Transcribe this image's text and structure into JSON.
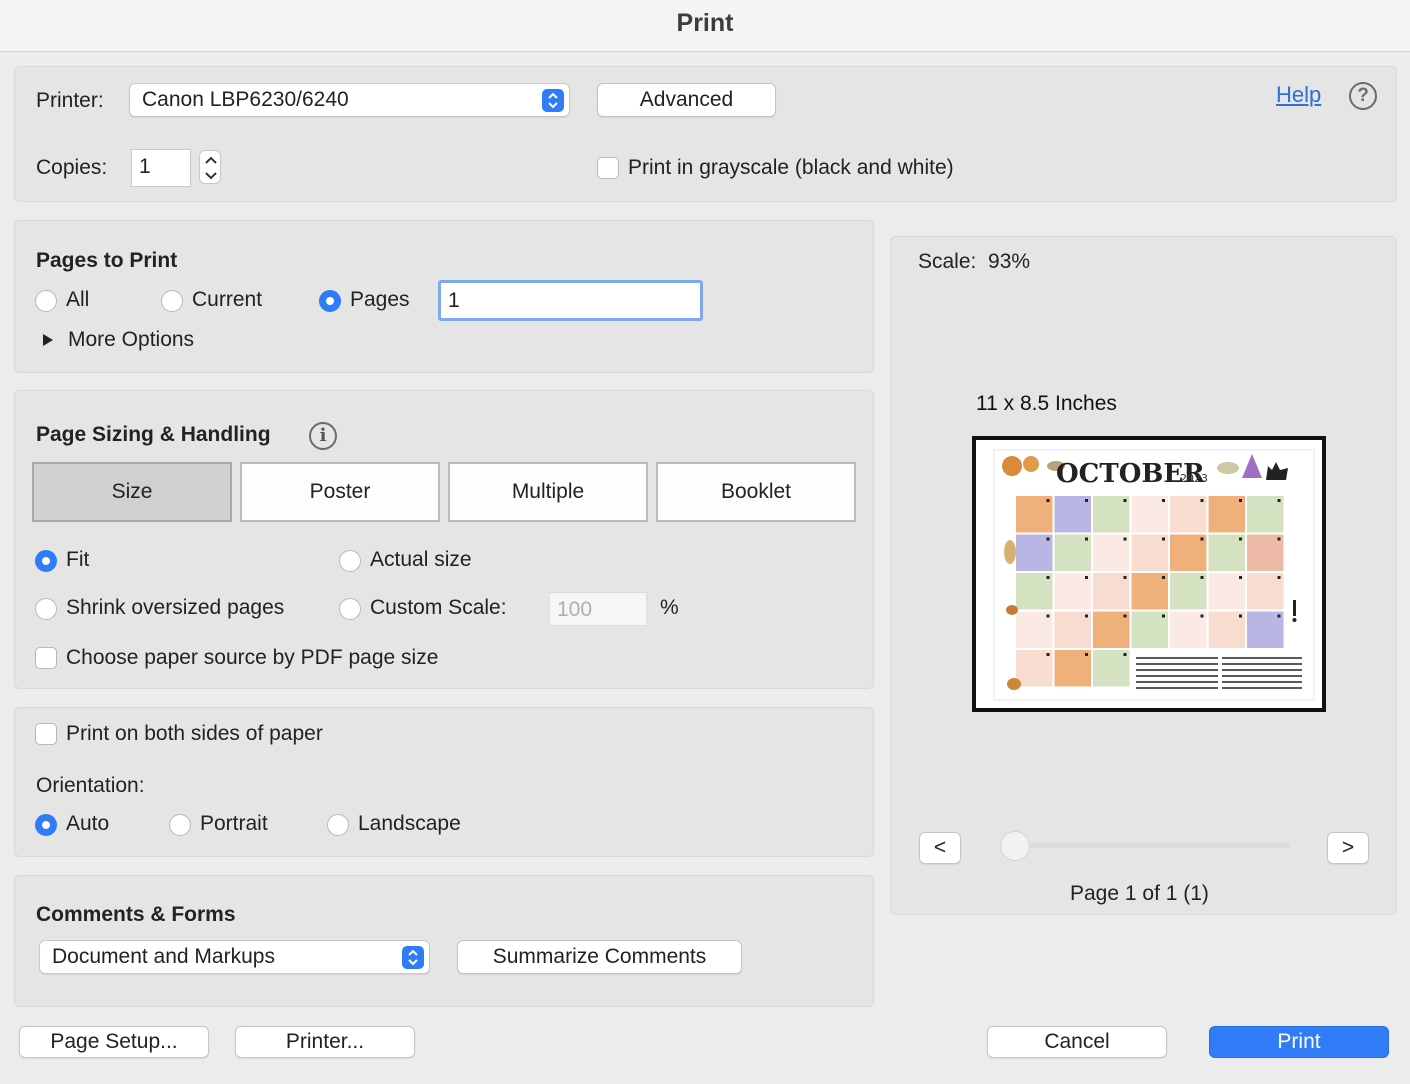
{
  "window": {
    "title": "Print"
  },
  "printer": {
    "label": "Printer:",
    "selected": "Canon LBP6230/6240",
    "advanced_label": "Advanced",
    "copies_label": "Copies:",
    "copies_value": "1",
    "grayscale_label": "Print in grayscale (black and white)",
    "grayscale_checked": false,
    "help_label": "Help",
    "help_icon_glyph": "?"
  },
  "pages_to_print": {
    "title": "Pages to Print",
    "options": [
      "All",
      "Current",
      "Pages"
    ],
    "selected": "Pages",
    "pages_value": "1",
    "more_options_label": "More Options"
  },
  "page_sizing": {
    "title": "Page Sizing & Handling",
    "info_icon_glyph": "i",
    "tabs": [
      "Size",
      "Poster",
      "Multiple",
      "Booklet"
    ],
    "selected_tab": "Size",
    "fit_label": "Fit",
    "actual_size_label": "Actual size",
    "shrink_label": "Shrink oversized pages",
    "custom_scale_label": "Custom Scale:",
    "custom_scale_value": "100",
    "percent_label": "%",
    "selected_option": "Fit",
    "paper_source_label": "Choose paper source by PDF page size"
  },
  "duplex": {
    "both_sides_label": "Print on both sides of paper",
    "orientation_label": "Orientation:",
    "orientation_options": [
      "Auto",
      "Portrait",
      "Landscape"
    ],
    "orientation_selected": "Auto"
  },
  "comments_forms": {
    "title": "Comments & Forms",
    "selected": "Document and Markups",
    "summarize_label": "Summarize Comments"
  },
  "preview": {
    "scale_label": "Scale:",
    "scale_value": "93%",
    "paper_size": "11 x 8.5 Inches",
    "page_indicator": "Page 1 of 1 (1)",
    "prev_label": "<",
    "next_label": ">",
    "page_slider_fraction": 0,
    "thumbnail": {
      "heading": "OCTOBER",
      "year": "2023"
    }
  },
  "footer": {
    "page_setup_label": "Page Setup...",
    "printer_label": "Printer...",
    "cancel_label": "Cancel",
    "print_label": "Print"
  },
  "colors": {
    "accent": "#2f7cf6",
    "cell_orange": "#efb07c",
    "cell_purple": "#b9b6e6",
    "cell_green": "#d5e2c2",
    "cell_pink": "#f8dcd0",
    "cell_light": "#fbeae4",
    "cell_salmon": "#eebba8"
  }
}
